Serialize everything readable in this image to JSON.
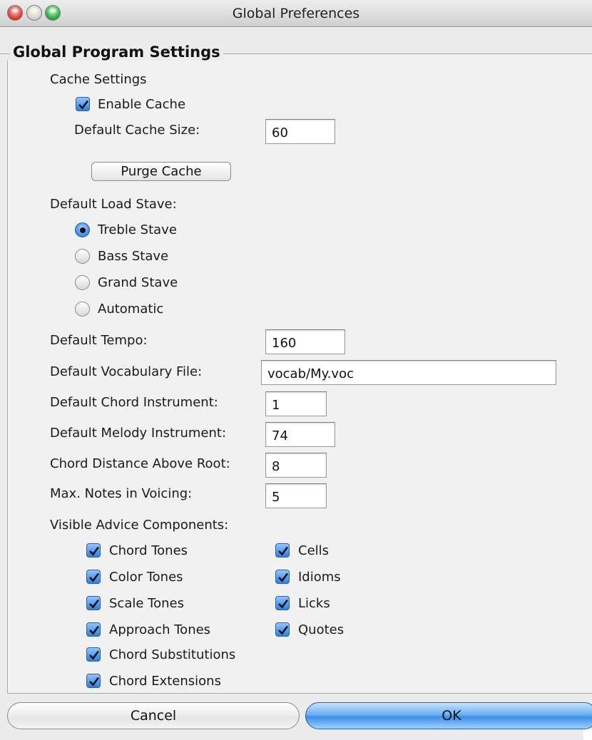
{
  "window": {
    "title": "Global Preferences"
  },
  "group": {
    "title": "Global Program Settings"
  },
  "cache": {
    "heading": "Cache Settings",
    "enable_label": "Enable Cache",
    "enable_checked": true,
    "size_label": "Default Cache Size:",
    "size_value": "60",
    "purge_label": "Purge Cache"
  },
  "stave": {
    "heading": "Default Load Stave:",
    "options": [
      {
        "label": "Treble Stave",
        "selected": true
      },
      {
        "label": "Bass Stave",
        "selected": false
      },
      {
        "label": "Grand Stave",
        "selected": false
      },
      {
        "label": "Automatic",
        "selected": false
      }
    ]
  },
  "settings": {
    "tempo_label": "Default Tempo:",
    "tempo_value": "160",
    "vocab_label": "Default Vocabulary File:",
    "vocab_value": "vocab/My.voc",
    "chord_instrument_label": "Default Chord Instrument:",
    "chord_instrument_value": "1",
    "melody_instrument_label": "Default Melody Instrument:",
    "melody_instrument_value": "74",
    "chord_distance_label": "Chord Distance Above Root:",
    "chord_distance_value": "8",
    "max_notes_label": "Max. Notes in Voicing:",
    "max_notes_value": "5"
  },
  "advice": {
    "heading": "Visible Advice Components:",
    "left": [
      {
        "label": "Chord Tones",
        "checked": true
      },
      {
        "label": "Color Tones",
        "checked": true
      },
      {
        "label": "Scale Tones",
        "checked": true
      },
      {
        "label": "Approach Tones",
        "checked": true
      },
      {
        "label": "Chord Substitutions",
        "checked": true
      },
      {
        "label": "Chord Extensions",
        "checked": true
      }
    ],
    "right": [
      {
        "label": "Cells",
        "checked": true
      },
      {
        "label": "Idioms",
        "checked": true
      },
      {
        "label": "Licks",
        "checked": true
      },
      {
        "label": "Quotes",
        "checked": true
      }
    ]
  },
  "buttons": {
    "cancel": "Cancel",
    "ok": "OK"
  },
  "colors": {
    "accent": "#3d8fe6",
    "checkbox": "#2f7fe0"
  }
}
